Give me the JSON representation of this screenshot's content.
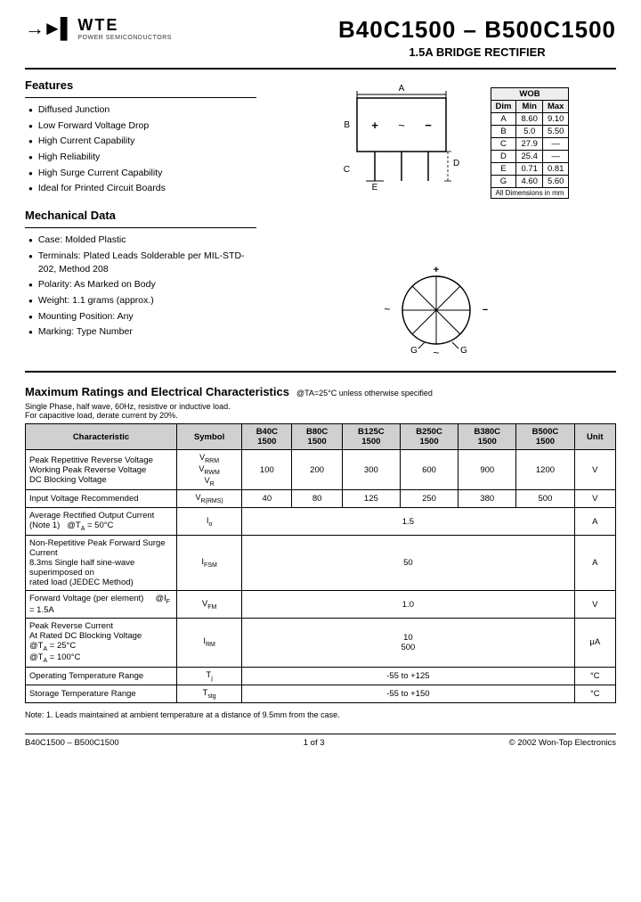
{
  "header": {
    "logo_symbol": "→|←",
    "logo_wte": "WTE",
    "logo_sub": "POWER SEMICONDUCTORS",
    "main_title": "B40C1500 – B500C1500",
    "sub_title": "1.5A BRIDGE RECTIFIER"
  },
  "features": {
    "title": "Features",
    "items": [
      "Diffused Junction",
      "Low Forward Voltage Drop",
      "High Current Capability",
      "High Reliability",
      "High Surge Current Capability",
      "Ideal for Printed Circuit Boards"
    ]
  },
  "mechanical": {
    "title": "Mechanical Data",
    "items": [
      "Case: Molded Plastic",
      "Terminals: Plated Leads Solderable per MIL-STD-202, Method 208",
      "Polarity: As Marked on Body",
      "Weight: 1.1 grams (approx.)",
      "Mounting Position: Any",
      "Marking: Type Number"
    ]
  },
  "dim_table": {
    "header": [
      "Dim",
      "Min",
      "Max"
    ],
    "col_header": "WOB",
    "rows": [
      [
        "A",
        "8.60",
        "9.10"
      ],
      [
        "B",
        "5.0",
        "5.50"
      ],
      [
        "C",
        "27.9",
        "—"
      ],
      [
        "D",
        "25.4",
        "—"
      ],
      [
        "E",
        "0.71",
        "0.81"
      ],
      [
        "G",
        "4.60",
        "5.60"
      ]
    ],
    "footnote": "All Dimensions in mm"
  },
  "max_ratings": {
    "title": "Maximum Ratings and Electrical Characteristics",
    "note": "@TA=25°C unless otherwise specified",
    "conditions": [
      "Single Phase, half wave, 60Hz, resistive or inductive load.",
      "For capacitive load, derate current by 20%."
    ],
    "table_headers": [
      "Characteristic",
      "Symbol",
      "B40C\n1500",
      "B80C\n1500",
      "B125C\n1500",
      "B250C\n1500",
      "B380C\n1500",
      "B500C\n1500",
      "Unit"
    ],
    "rows": [
      {
        "char": "Peak Repetitive Reverse Voltage\nWorking Peak Reverse Voltage\nDC Blocking Voltage",
        "symbol": "VRRM\nVRWM\nVR",
        "values": [
          "100",
          "200",
          "300",
          "600",
          "900",
          "1200"
        ],
        "unit": "V"
      },
      {
        "char": "Input Voltage Recommended",
        "symbol": "VR(RMS)",
        "values": [
          "40",
          "80",
          "125",
          "250",
          "380",
          "500"
        ],
        "unit": "V"
      },
      {
        "char": "Average Rectified Output Current (Note 1)   @TA = 50°C",
        "symbol": "Io",
        "values": [
          "",
          "",
          "1.5",
          "",
          "",
          ""
        ],
        "unit": "A",
        "single_val": "1.5"
      },
      {
        "char": "Non-Repetitive Peak Forward Surge Current\n8.3ms Single half sine-wave superimposed on\nrated load (JEDEC Method)",
        "symbol": "IFSM",
        "values": [
          "",
          "",
          "50",
          "",
          "",
          ""
        ],
        "unit": "A",
        "single_val": "50"
      },
      {
        "char": "Forward Voltage (per element)",
        "char_sub": "@IF = 1.5A",
        "symbol": "VFM",
        "values": [
          "",
          "",
          "1.0",
          "",
          "",
          ""
        ],
        "unit": "V",
        "single_val": "1.0"
      },
      {
        "char": "Peak Reverse Current\nAt Rated DC Blocking Voltage",
        "char_sub1": "@TA = 25°C",
        "char_sub2": "@TA = 100°C",
        "symbol": "IRM",
        "values": [
          "",
          "",
          "10\n500",
          "",
          "",
          ""
        ],
        "unit": "μA",
        "single_val": "10\n500"
      },
      {
        "char": "Operating Temperature Range",
        "symbol": "Tj",
        "values": [
          "",
          "",
          "-55 to +125",
          "",
          "",
          ""
        ],
        "unit": "°C",
        "single_val": "-55 to +125"
      },
      {
        "char": "Storage Temperature Range",
        "symbol": "Tstg",
        "values": [
          "",
          "",
          "-55 to +150",
          "",
          "",
          ""
        ],
        "unit": "°C",
        "single_val": "-55 to +150"
      }
    ]
  },
  "footer": {
    "left": "B40C1500 – B500C1500",
    "center": "1 of 3",
    "right": "© 2002 Won-Top Electronics"
  },
  "note": "Note:  1. Leads maintained at ambient temperature at a distance of 9.5mm from the case."
}
